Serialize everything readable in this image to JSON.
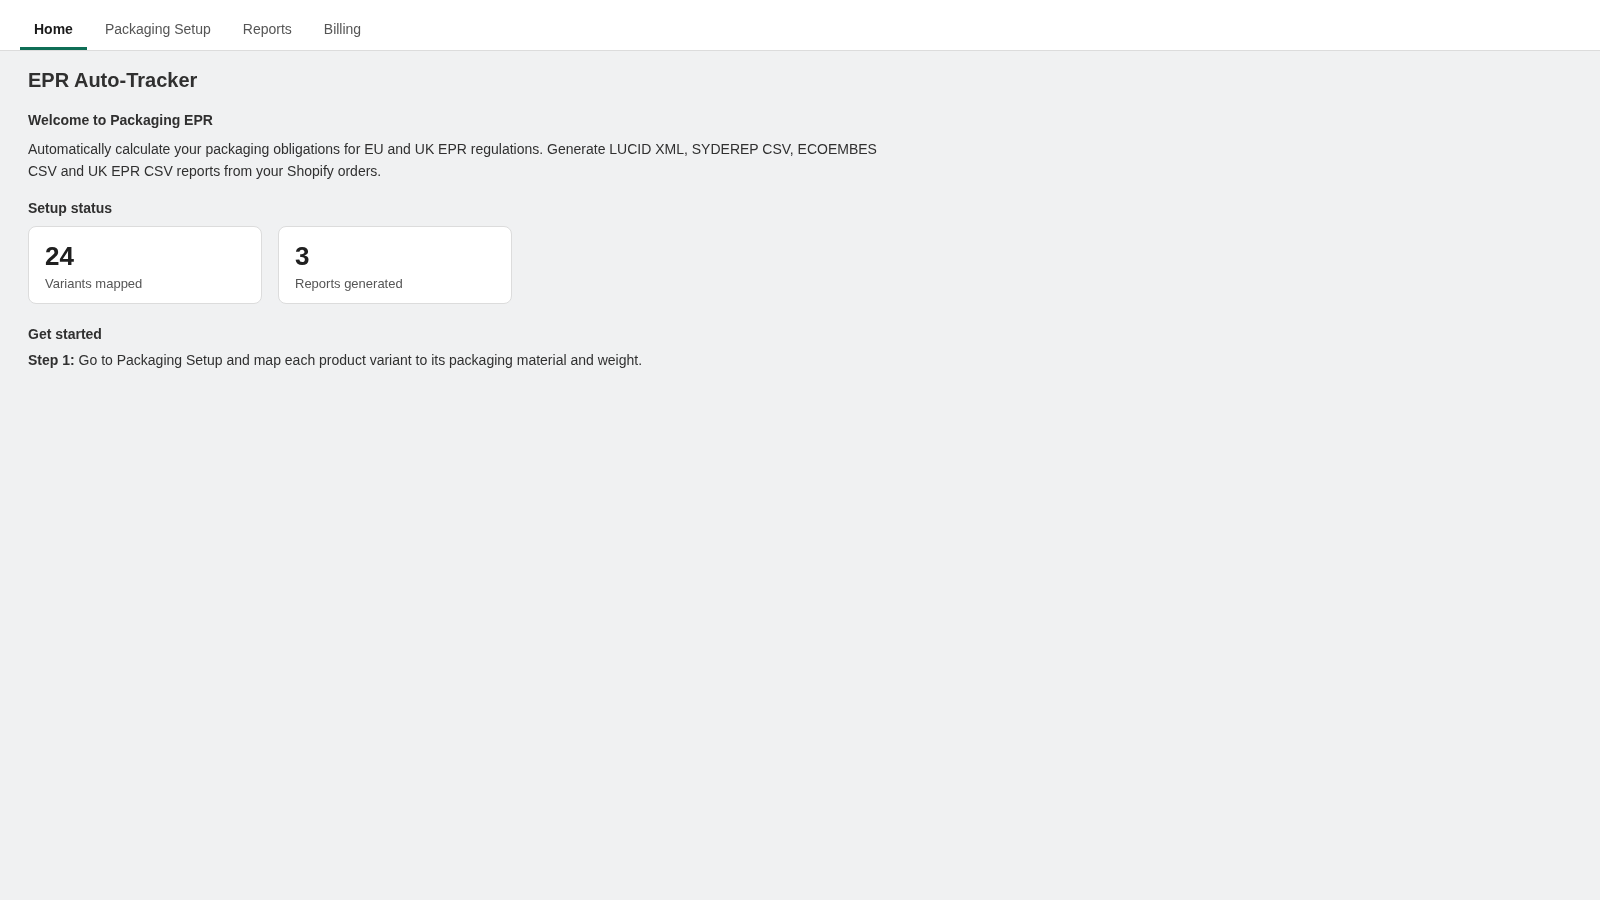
{
  "tabs": [
    {
      "label": "Home",
      "selected": true
    },
    {
      "label": "Packaging Setup",
      "selected": false
    },
    {
      "label": "Reports",
      "selected": false
    },
    {
      "label": "Billing",
      "selected": false
    }
  ],
  "page": {
    "title": "EPR Auto-Tracker",
    "subtitle": "Welcome to Packaging EPR",
    "description": "Automatically calculate your packaging obligations for EU and UK EPR regulations. Generate LUCID XML, SYDEREP CSV, ECOEMBES CSV and UK EPR CSV reports from your Shopify orders."
  },
  "setup_status": {
    "heading": "Setup status",
    "stats": [
      {
        "value": "24",
        "label": "Variants mapped"
      },
      {
        "value": "3",
        "label": "Reports generated"
      }
    ]
  },
  "get_started": {
    "heading": "Get started",
    "steps": [
      "**Step 1:** Go to Packaging Setup and map each product variant to its packaging material and weight."
    ]
  }
}
